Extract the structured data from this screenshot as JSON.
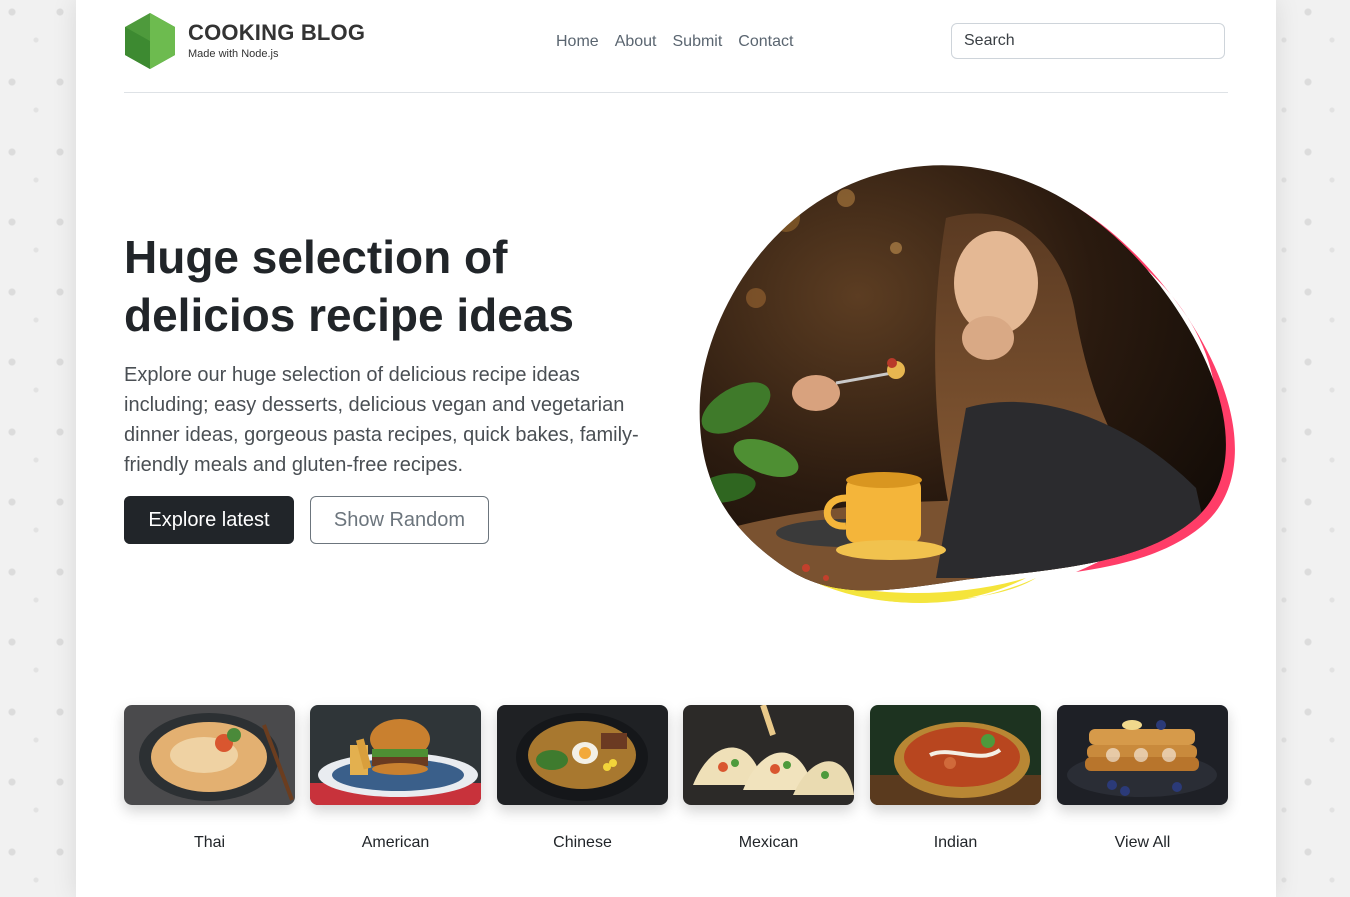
{
  "header": {
    "brand": "COOKING BLOG",
    "tagline": "Made with Node.js",
    "logo_icon": "nodejs-hexagon-icon",
    "nav": [
      {
        "label": "Home"
      },
      {
        "label": "About"
      },
      {
        "label": "Submit"
      },
      {
        "label": "Contact"
      }
    ],
    "search": {
      "placeholder": "Search",
      "value": ""
    }
  },
  "hero": {
    "title": "Huge selection of delicios recipe ideas",
    "lead": "Explore our huge selection of delicious recipe ideas including; easy desserts, delicious vegan and vegetarian dinner ideas, gorgeous pasta recipes, quick bakes, family-friendly meals and gluten-free recipes.",
    "primary_button": "Explore latest",
    "secondary_button": "Show Random",
    "image": "woman-eating-pasta-photo"
  },
  "categories": [
    {
      "label": "Thai",
      "image": "thai-curry-bowl-photo"
    },
    {
      "label": "American",
      "image": "burger-and-fries-photo"
    },
    {
      "label": "Chinese",
      "image": "noodle-bowl-photo"
    },
    {
      "label": "Mexican",
      "image": "tacos-photo"
    },
    {
      "label": "Indian",
      "image": "indian-curry-photo"
    },
    {
      "label": "View All",
      "image": "pancake-stack-photo"
    }
  ],
  "colors": {
    "primary_dark": "#212529",
    "nav_text": "#5a6570",
    "blob_accent_pink": "#ff3d68",
    "blob_accent_yellow": "#f5e43a",
    "logo_green": "#5aa544"
  }
}
